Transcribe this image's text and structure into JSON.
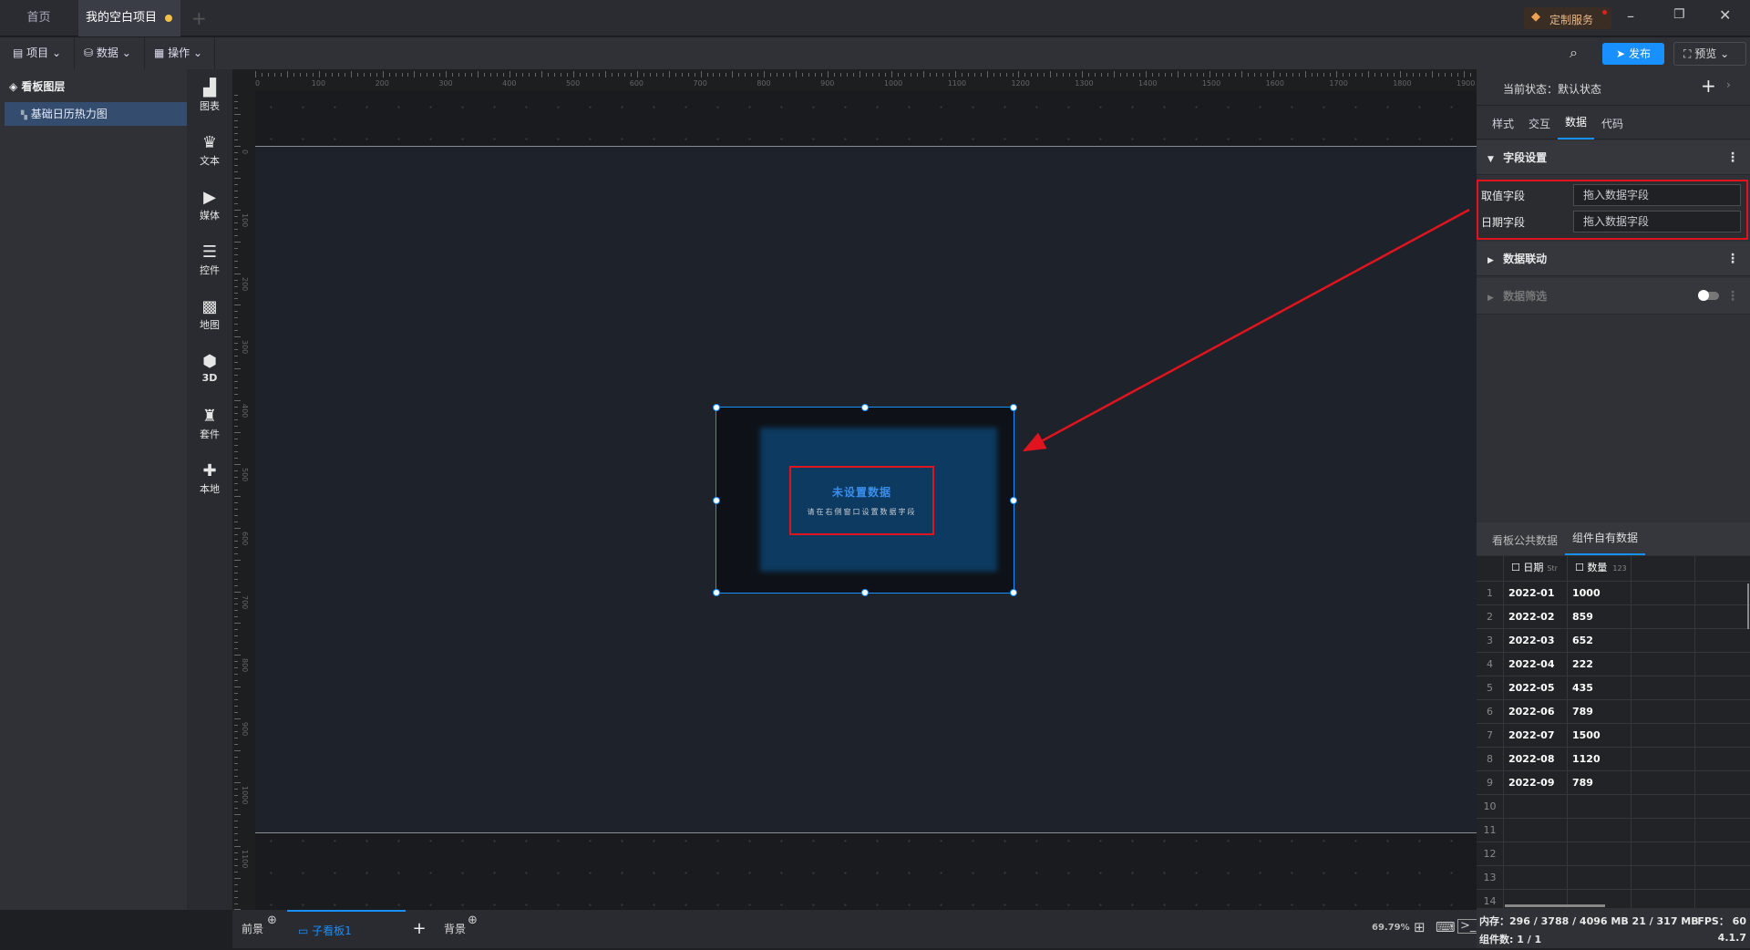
{
  "tabs": [
    {
      "label": "首页"
    },
    {
      "label": "我的空白项目"
    }
  ],
  "window": {
    "custom_service": "定制服务"
  },
  "toolbar": {
    "project": "项目",
    "data": "数据",
    "operation": "操作",
    "publish": "发布",
    "preview": "预览"
  },
  "layers": {
    "title": "看板图层",
    "items": [
      {
        "label": "基础日历热力图"
      }
    ]
  },
  "components": [
    {
      "label": "图表"
    },
    {
      "label": "文本"
    },
    {
      "label": "媒体"
    },
    {
      "label": "控件"
    },
    {
      "label": "地图"
    },
    {
      "label": "3D"
    },
    {
      "label": "套件"
    },
    {
      "label": "本地"
    }
  ],
  "ruler": {
    "h": [
      "0",
      "100",
      "200",
      "300",
      "400",
      "500",
      "600",
      "700",
      "800",
      "900",
      "1000",
      "1100",
      "1200",
      "1300",
      "1400",
      "1500",
      "1600",
      "1700",
      "1800",
      "1900"
    ],
    "v": [
      "0",
      "100",
      "200",
      "300",
      "400",
      "500",
      "600",
      "700",
      "800",
      "900",
      "1000",
      "1100"
    ]
  },
  "widget": {
    "title": "未设置数据",
    "hint": "请在右侧窗口设置数据字段"
  },
  "bottom": {
    "foreground": "前景",
    "subboard": "子看板1",
    "background": "背景",
    "zoom": "69.79%"
  },
  "right": {
    "state_label": "当前状态：默认状态",
    "tabs": [
      "样式",
      "交互",
      "数据",
      "代码"
    ],
    "field_settings": "字段设置",
    "value_field_label": "取值字段",
    "value_field_placeholder": "拖入数据字段",
    "date_field_label": "日期字段",
    "date_field_placeholder": "拖入数据字段",
    "data_linkage": "数据联动",
    "data_filter": "数据筛选",
    "data_tabs": [
      "看板公共数据",
      "组件自有数据"
    ]
  },
  "table": {
    "columns": [
      {
        "name": "日期",
        "type": "Str"
      },
      {
        "name": "数量",
        "type": "123"
      }
    ],
    "rows": [
      [
        "2022-01",
        "1000"
      ],
      [
        "2022-02",
        "859"
      ],
      [
        "2022-03",
        "652"
      ],
      [
        "2022-04",
        "222"
      ],
      [
        "2022-05",
        "435"
      ],
      [
        "2022-06",
        "789"
      ],
      [
        "2022-07",
        "1500"
      ],
      [
        "2022-08",
        "1120"
      ],
      [
        "2022-09",
        "789"
      ],
      [
        "",
        ""
      ],
      [
        "",
        ""
      ],
      [
        "",
        ""
      ],
      [
        "",
        ""
      ],
      [
        "",
        ""
      ]
    ]
  },
  "status": {
    "memory": "内存：296 / 3788 / 4096 MB  21 / 317 MB",
    "fps": "FPS：  60",
    "components": "组件数: 1 / 1",
    "version": "4.1.7"
  },
  "colors": {
    "accent": "#1890ff",
    "highlight": "#e0141e"
  }
}
